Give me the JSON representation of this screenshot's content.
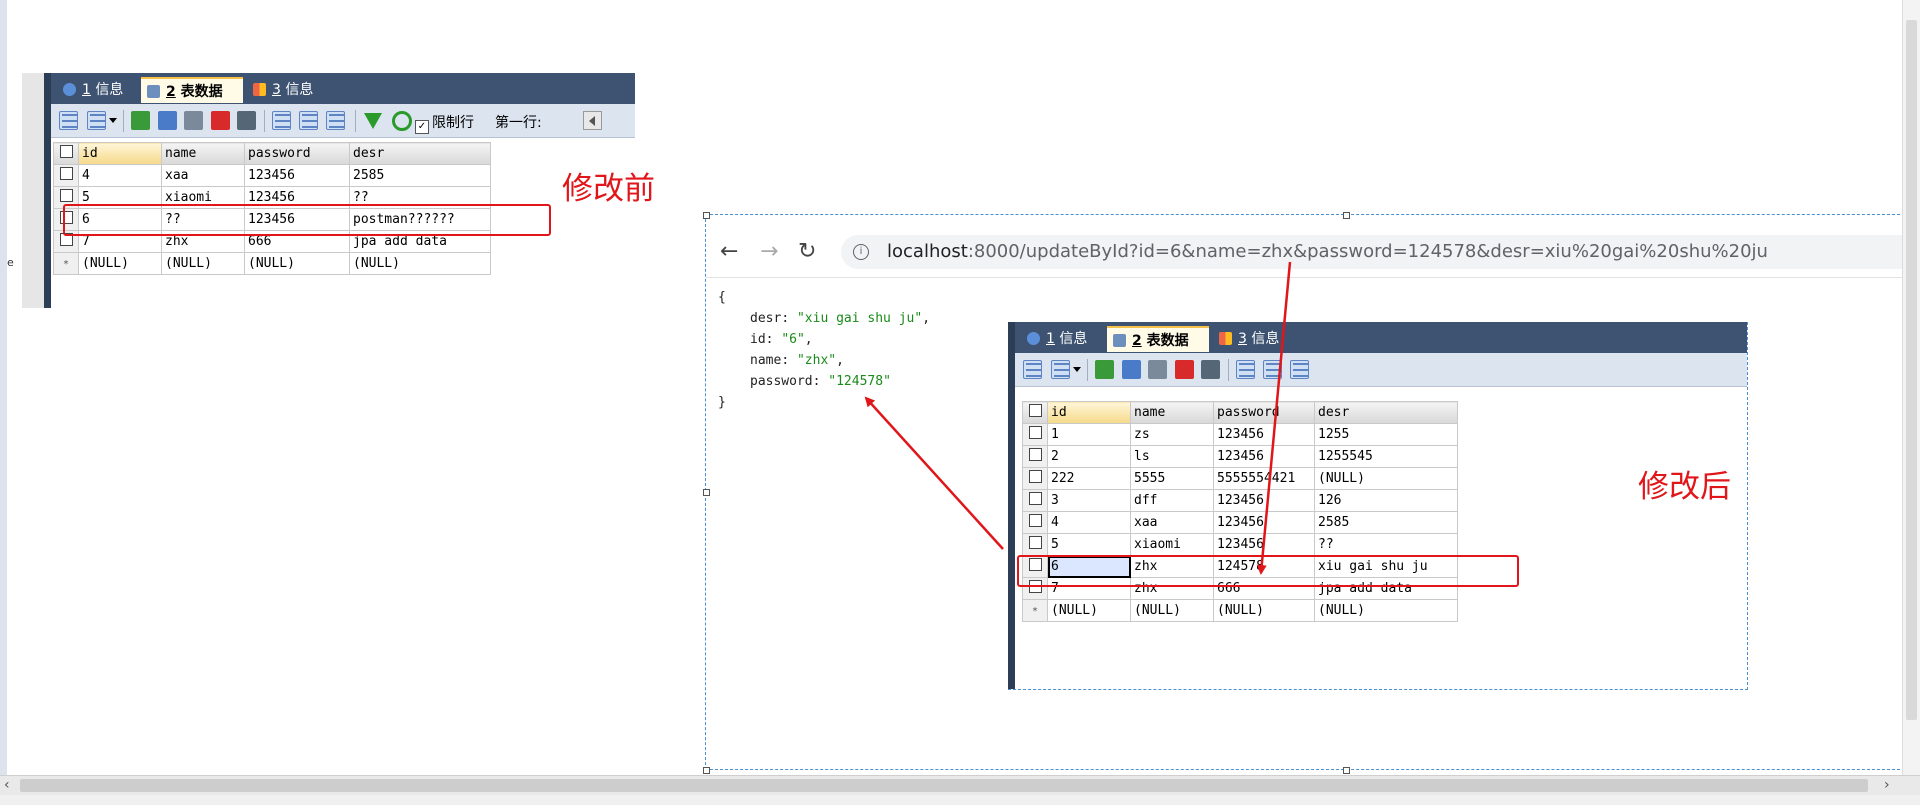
{
  "tabs": [
    {
      "num": "1",
      "label": "信息"
    },
    {
      "num": "2",
      "label": "表数据"
    },
    {
      "num": "3",
      "label": "信息"
    }
  ],
  "toolbar": {
    "limit_label": "限制行",
    "first_row_label": "第一行:"
  },
  "columns": [
    "id",
    "name",
    "password",
    "desr"
  ],
  "before_table": {
    "rows": [
      [
        "4",
        "xaa",
        "123456",
        "2585"
      ],
      [
        "5",
        "xiaomi",
        "123456",
        "??"
      ],
      [
        "6",
        "??",
        "123456",
        "postman??????"
      ],
      [
        "7",
        "zhx",
        "666",
        "jpa add data"
      ]
    ],
    "new_row": [
      "(NULL)",
      "(NULL)",
      "(NULL)",
      "(NULL)"
    ]
  },
  "after_table": {
    "rows": [
      [
        "1",
        "zs",
        "123456",
        "1255"
      ],
      [
        "2",
        "ls",
        "123456",
        "1255545"
      ],
      [
        "222",
        "5555",
        "5555554421",
        "(NULL)"
      ],
      [
        "3",
        "dff",
        "123456",
        "126"
      ],
      [
        "4",
        "xaa",
        "123456",
        "2585"
      ],
      [
        "5",
        "xiaomi",
        "123456",
        "??"
      ],
      [
        "6",
        "zhx",
        "124578",
        "xiu gai shu ju"
      ],
      [
        "7",
        "zhx",
        "666",
        "jpa add data"
      ]
    ],
    "new_row": [
      "(NULL)",
      "(NULL)",
      "(NULL)",
      "(NULL)"
    ]
  },
  "annotations": {
    "before": "修改前",
    "after": "修改后"
  },
  "browser": {
    "url_host": "localhost",
    "url_path": ":8000/updateById?id=6&name=zhx&password=124578&desr=xiu%20gai%20shu%20ju",
    "json": {
      "open": "{",
      "close": "}",
      "desr_key": "desr",
      "desr_val": "\"xiu gai shu ju\"",
      "id_key": "id",
      "id_val": "\"6\"",
      "name_key": "name",
      "name_val": "\"zhx\"",
      "password_key": "password",
      "password_val": "\"124578\""
    }
  },
  "colors": {
    "annotation_red": "#e0161a",
    "tabbar_navy": "#3e5372",
    "json_string_green": "#1a8a1a"
  },
  "misc": {
    "edge_glyph": "e"
  }
}
